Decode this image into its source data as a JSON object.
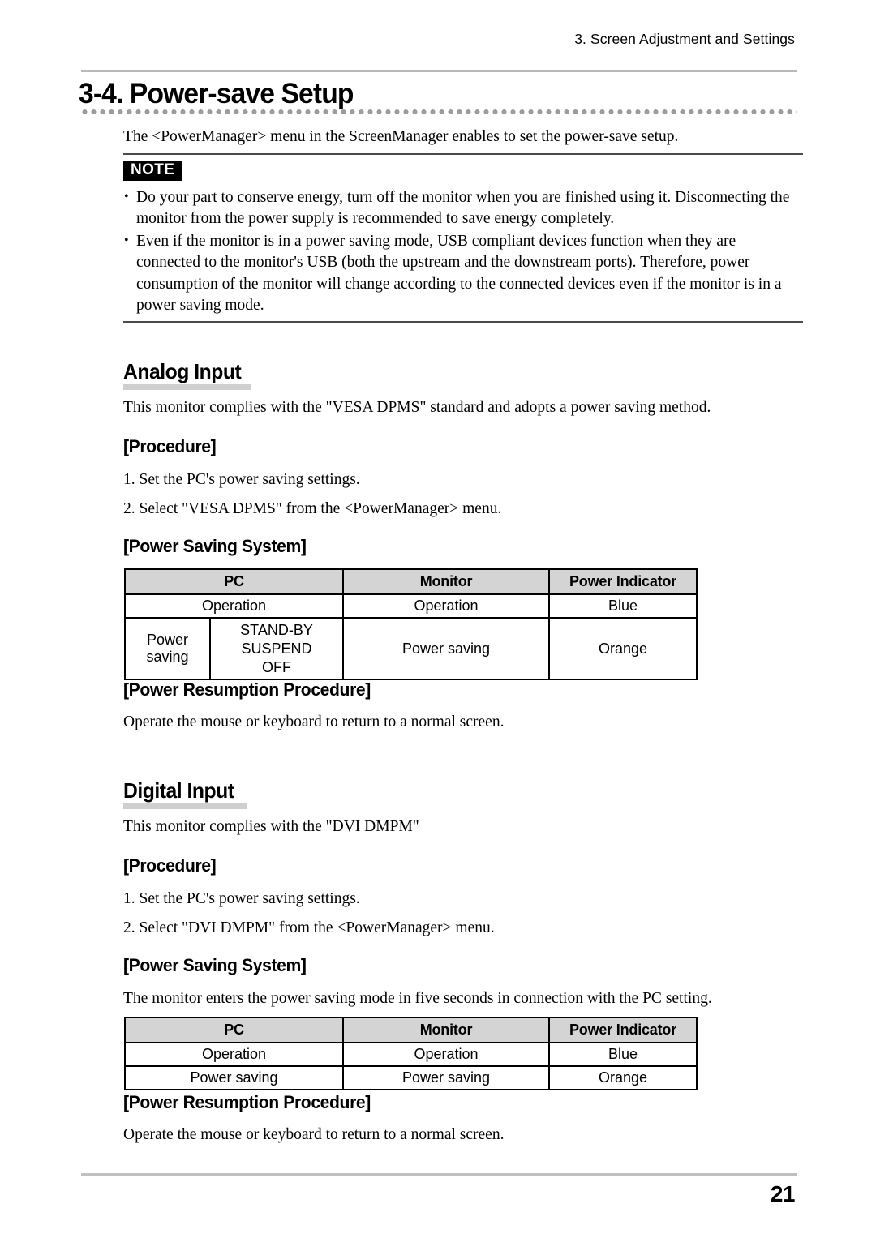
{
  "header": {
    "running_head": "3. Screen Adjustment and Settings",
    "page_number": "21"
  },
  "chapter": {
    "title": "3-4. Power-save Setup",
    "intro": "The <PowerManager> menu in the ScreenManager enables to set the power-save setup."
  },
  "note": {
    "badge": "NOTE",
    "items": [
      "Do your part to conserve energy, turn off the monitor when you are finished using it. Disconnecting the monitor from the power supply is recommended to save energy completely.",
      "Even if the monitor is in a power saving mode, USB compliant devices function when they are connected to the monitor's USB (both the upstream and the downstream ports). Therefore, power consumption of the monitor will change according to the connected devices even if the monitor is in a power saving mode."
    ]
  },
  "analog": {
    "heading": "Analog Input",
    "intro": "This monitor complies with the \"VESA DPMS\" standard and adopts a power saving method.",
    "procedure_heading": "[Procedure]",
    "procedure_steps": [
      "1. Set the PC's power saving settings.",
      "2. Select \"VESA DPMS\" from the <PowerManager> menu."
    ],
    "power_saving_heading": "[Power Saving System]",
    "table": {
      "columns": [
        "PC",
        "Monitor",
        "Power Indicator"
      ],
      "rows": [
        {
          "pc_left": "",
          "pc_right": "Operation",
          "monitor": "Operation",
          "indicator": "Blue"
        },
        {
          "pc_left": "Power saving",
          "pc_modes": [
            "STAND-BY",
            "SUSPEND",
            "OFF"
          ],
          "monitor": "Power saving",
          "indicator": "Orange"
        }
      ]
    },
    "resumption_heading": "[Power Resumption Procedure]",
    "resumption_text": "Operate the mouse or keyboard to return to a normal screen."
  },
  "digital": {
    "heading": "Digital Input",
    "intro": "This monitor complies with the \"DVI DMPM\"",
    "procedure_heading": "[Procedure]",
    "procedure_steps": [
      "1. Set the PC's power saving settings.",
      "2. Select \"DVI DMPM\" from the <PowerManager> menu."
    ],
    "power_saving_heading": "[Power Saving System]",
    "power_saving_note": "The monitor enters the power saving mode in five seconds in connection with the PC setting.",
    "table": {
      "columns": [
        "PC",
        "Monitor",
        "Power Indicator"
      ],
      "rows": [
        {
          "pc": "Operation",
          "monitor": "Operation",
          "indicator": "Blue"
        },
        {
          "pc": "Power saving",
          "monitor": "Power saving",
          "indicator": "Orange"
        }
      ]
    },
    "resumption_heading": "[Power Resumption Procedure]",
    "resumption_text": "Operate the mouse or keyboard to return to a normal screen."
  }
}
